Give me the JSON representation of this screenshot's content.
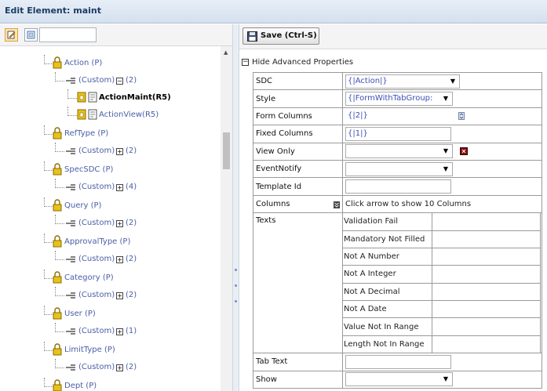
{
  "window": {
    "title": "Edit Element: maint"
  },
  "left_toolbar": {
    "button1_icon": "edit-tree-icon",
    "button2_icon": "view-tree-icon",
    "search": {
      "value": "",
      "placeholder": ""
    }
  },
  "tree": {
    "action": {
      "label": "Action (P)",
      "custom_label": "(Custom)",
      "custom_count": "(2)",
      "children": [
        {
          "label": "ActionMaint(R5)",
          "bold": true
        },
        {
          "label": "ActionView(R5)",
          "bold": false
        }
      ]
    },
    "nodes": [
      {
        "label": "RefType (P)",
        "custom_label": "(Custom)",
        "custom_count": "(2)"
      },
      {
        "label": "SpecSDC (P)",
        "custom_label": "(Custom)",
        "custom_count": "(4)"
      },
      {
        "label": "Query (P)",
        "custom_label": "(Custom)",
        "custom_count": "(2)"
      },
      {
        "label": "ApprovalType (P)",
        "custom_label": "(Custom)",
        "custom_count": "(2)"
      },
      {
        "label": "Category (P)",
        "custom_label": "(Custom)",
        "custom_count": "(2)"
      },
      {
        "label": "User (P)",
        "custom_label": "(Custom)",
        "custom_count": "(1)"
      },
      {
        "label": "LimitType (P)",
        "custom_label": "(Custom)",
        "custom_count": "(2)"
      },
      {
        "label": "Dept (P)"
      }
    ]
  },
  "right_toolbar": {
    "save_label": "Save (Ctrl-S)"
  },
  "advanced": {
    "label": "Hide Advanced Properties"
  },
  "properties": {
    "sdc": {
      "name": "SDC",
      "value": "{|Action|}"
    },
    "style": {
      "name": "Style",
      "value": "{|FormWithTabGroup:"
    },
    "form_columns": {
      "name": "Form Columns",
      "value": "{|2|}"
    },
    "fixed_columns": {
      "name": "Fixed Columns",
      "value": "{|1|}"
    },
    "view_only": {
      "name": "View Only",
      "value": ""
    },
    "event_notify": {
      "name": "EventNotify",
      "value": ""
    },
    "template_id": {
      "name": "Template Id",
      "value": ""
    },
    "columns": {
      "name": "Columns",
      "value": "Click arrow to show 10 Columns"
    },
    "texts": {
      "name": "Texts",
      "items": [
        {
          "label": "Validation Fail",
          "value": ""
        },
        {
          "label": "Mandatory Not Filled",
          "value": ""
        },
        {
          "label": "Not A Number",
          "value": ""
        },
        {
          "label": "Not A Integer",
          "value": ""
        },
        {
          "label": "Not A Decimal",
          "value": ""
        },
        {
          "label": "Not A Date",
          "value": ""
        },
        {
          "label": "Value Not In Range",
          "value": ""
        },
        {
          "label": "Length Not In Range",
          "value": ""
        }
      ]
    },
    "tab_text": {
      "name": "Tab Text",
      "value": ""
    },
    "show": {
      "name": "Show",
      "value": ""
    }
  },
  "colors": {
    "title_text": "#1b3d66",
    "link_text": "#4a5ea8",
    "value_text": "#3b50b8",
    "lock_icon": "#e8c11a"
  }
}
